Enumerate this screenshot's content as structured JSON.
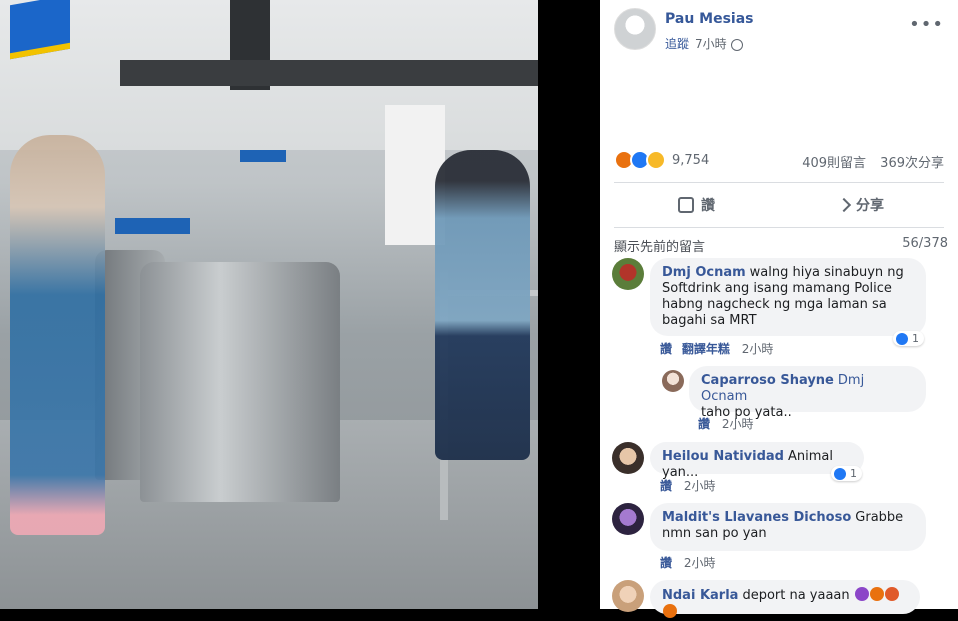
{
  "post": {
    "author": "Pau Mesias",
    "follow": "追蹤",
    "time": "7小時",
    "more": "•••",
    "reaction_count": "9,754",
    "comment_count": "409則留言",
    "share_count": "369次分享"
  },
  "actions": {
    "like": "讚",
    "share": "分享"
  },
  "comments_header": {
    "previous": "顯示先前的留言",
    "pager": "56/378"
  },
  "comments": [
    {
      "name": "Dmj Ocnam",
      "text": "walng hiya sinabuyn ng Softdrink ang isang mamang Police habng nagcheck ng mga laman sa bagahi sa MRT",
      "like": "讚",
      "translate": "翻譯年糕",
      "time": "2小時",
      "likes": "1"
    },
    {
      "name": "Caparroso Shayne",
      "tag": "Dmj Ocnam",
      "text": "taho po yata..",
      "like": "讚",
      "time": "2小時"
    },
    {
      "name": "Heilou Natividad",
      "text": "Animal yan...",
      "like": "讚",
      "time": "2小時",
      "likes": "1"
    },
    {
      "name": "Maldit's Llavanes Dichoso",
      "text": "Grabbe nmn san po yan",
      "like": "讚",
      "time": "2小時"
    },
    {
      "name": "Ndai Karla",
      "text": "deport na yaaan"
    }
  ],
  "colors": {
    "link": "#385898",
    "bubble": "#f2f3f5",
    "like_blue": "#2078f4"
  }
}
